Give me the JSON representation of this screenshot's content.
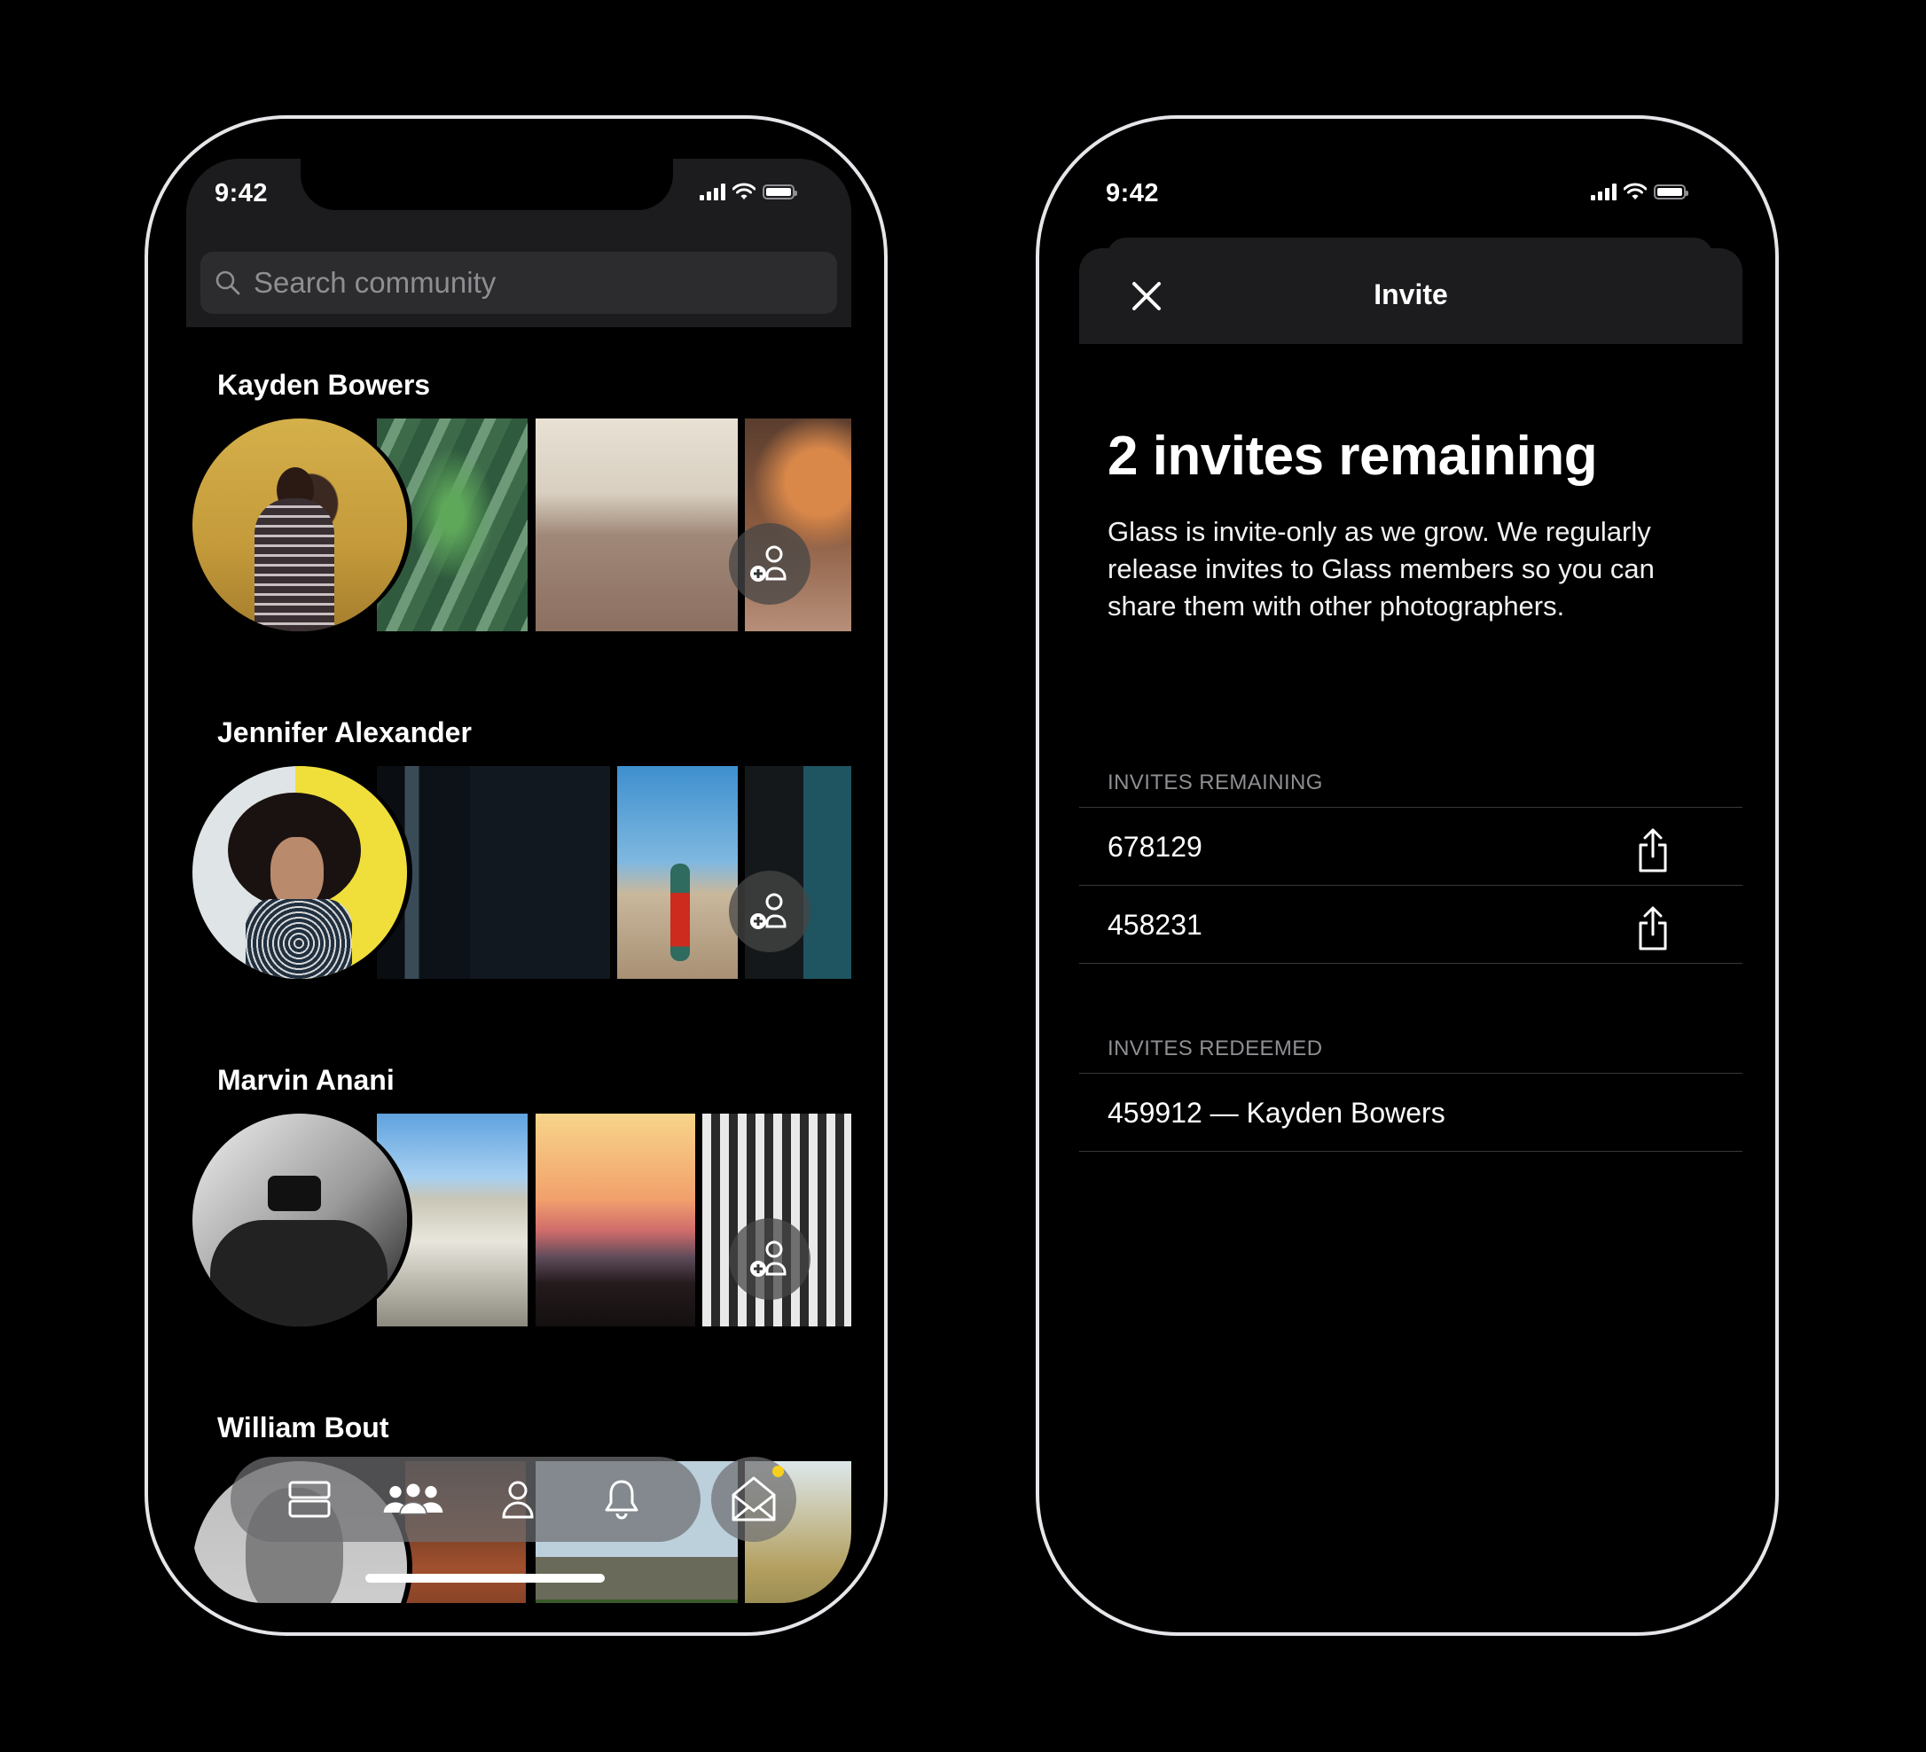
{
  "status_bar": {
    "time": "9:42",
    "icons": [
      "signal-icon",
      "wifi-icon",
      "battery-icon"
    ]
  },
  "community": {
    "search": {
      "placeholder": "Search community",
      "value": "",
      "icon": "search-icon"
    },
    "people": [
      {
        "name": "Kayden Bowers",
        "action": "add-friend-icon"
      },
      {
        "name": "Jennifer Alexander",
        "action": "add-friend-icon"
      },
      {
        "name": "Marvin Anani",
        "action": "add-friend-icon"
      },
      {
        "name": "William Bout",
        "action": "add-friend-icon"
      }
    ],
    "tabbar": {
      "tabs": [
        {
          "name": "feed",
          "icon": "feed-icon",
          "active": false
        },
        {
          "name": "community",
          "icon": "community-icon",
          "active": true
        },
        {
          "name": "profile",
          "icon": "profile-icon",
          "active": false
        },
        {
          "name": "notifications",
          "icon": "bell-icon",
          "active": false
        }
      ],
      "inbox": {
        "icon": "envelope-open-icon",
        "has_badge": true,
        "badge_color": "#F7D01E"
      }
    }
  },
  "invite": {
    "title": "Invite",
    "close_icon": "close-icon",
    "headline": "2 invites remaining",
    "description": "Glass is invite-only as we grow. We regularly release invites to Glass members so you can share them with other photographers.",
    "remaining_label": "INVITES REMAINING",
    "remaining": [
      {
        "code": "678129",
        "action": "share-icon"
      },
      {
        "code": "458231",
        "action": "share-icon"
      }
    ],
    "redeemed_label": "INVITES REDEEMED",
    "redeemed": [
      {
        "text": "459912 — Kayden Bowers"
      }
    ]
  },
  "colors": {
    "background": "#000000",
    "surface": "#1C1C1E",
    "search_fill": "#2C2C2E",
    "secondary_text": "#8E8E93",
    "badge": "#F7D01E"
  }
}
